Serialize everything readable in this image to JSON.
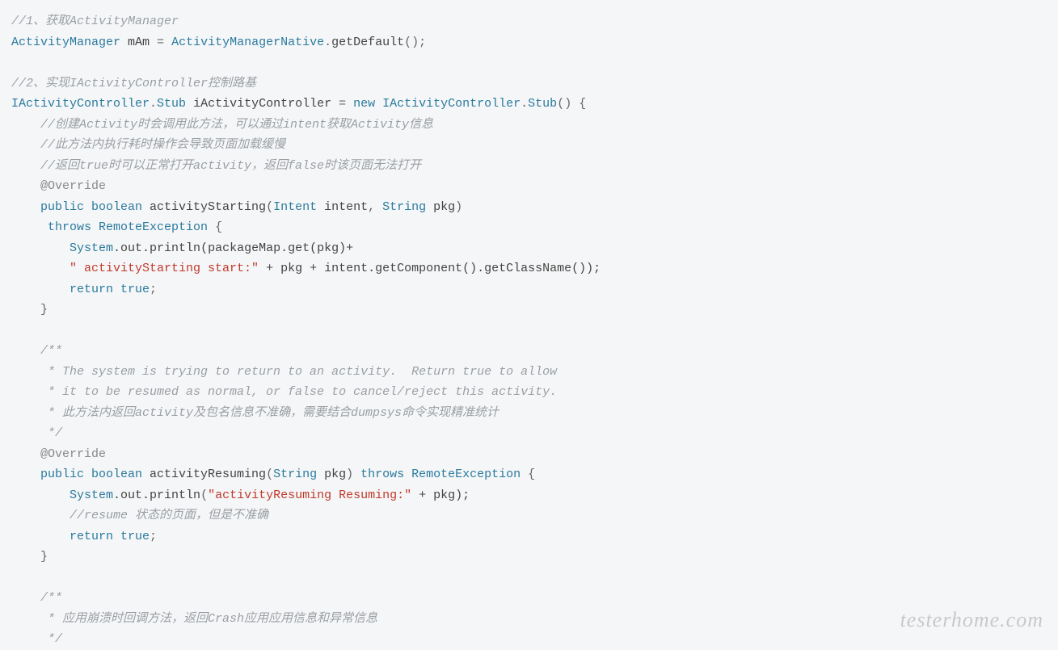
{
  "code": {
    "t": {
      "c1": "//1、获取ActivityManager",
      "ty_am": "ActivityManager",
      "var_mam": " mAm ",
      "eq": "=",
      "ty_amn": " ActivityManagerNative",
      "dot1": ".",
      "m_getdef": "getDefault",
      "paren_semi": "();",
      "c2": "//2、实现IActivityController控制路基",
      "ty_iac": "IActivityController",
      "dot2": ".",
      "ty_stub": "Stub",
      "var_iac": " iActivityController ",
      "kw_new": " new ",
      "ty_iac2": "IActivityController",
      "dot3": ".",
      "ty_stub2": "Stub",
      "open_brace": "() {",
      "c3": "    //创建Activity时会调用此方法，可以通过intent获取Activity信息",
      "c4": "    //此方法内执行耗时操作会导致页面加载缓慢",
      "c5": "    //返回true时可以正常打开activity，返回false时该页面无法打开",
      "ann_override1": "    @Override",
      "kw_public1": "    public",
      "kw_boolean1": " boolean ",
      "m_actstart": "activityStarting",
      "open_p1": "(",
      "ty_intent": "Intent",
      "var_intent": " intent",
      "comma1": ",",
      "ty_string1": " String",
      "var_pkg1": " pkg",
      "close_p1": ")",
      "kw_throws1": "     throws ",
      "ty_remex1": "RemoteException",
      "open_b1": " {",
      "ty_system1": "        System",
      "dot_out1": ".out.",
      "m_println1": "println",
      "print_args1": "(packageMap.get(pkg)+",
      "str1": "        \" activityStarting start:\"",
      "str1_rest": " + pkg + intent.getComponent().getClassName());",
      "kw_return1": "        return",
      "kw_true1": " true",
      "semi1": ";",
      "close_b1": "    }",
      "jdoc_open1": "    /**",
      "jdoc_l1": "     * The system is trying to return to an activity.  Return true to allow",
      "jdoc_l2": "     * it to be resumed as normal, or false to cancel/reject this activity.",
      "jdoc_l3": "     * 此方法内返回activity及包名信息不准确，需要结合dumpsys命令实现精准统计",
      "jdoc_close1": "     */",
      "ann_override2": "    @Override",
      "kw_public2": "    public",
      "kw_boolean2": " boolean ",
      "m_actres": "activityResuming",
      "open_p2": "(",
      "ty_string2": "String",
      "var_pkg2": " pkg",
      "close_p2": ")",
      "kw_throws2": " throws ",
      "ty_remex2": "RemoteException",
      "open_b2": " {",
      "ty_system2": "        System",
      "dot_out2": ".out.",
      "m_println2": "println",
      "open_p3": "(",
      "str2": "\"activityResuming Resuming:\"",
      "str2_rest": " + pkg);",
      "c6": "        //resume 状态的页面，但是不准确",
      "kw_return2": "        return",
      "kw_true2": " true",
      "semi2": ";",
      "close_b2": "    }",
      "jdoc_open2": "    /**",
      "jdoc_l4": "     * 应用崩溃时回调方法，返回Crash应用应用信息和异常信息",
      "jdoc_close2": "     */"
    }
  },
  "watermark": "testerhome.com"
}
